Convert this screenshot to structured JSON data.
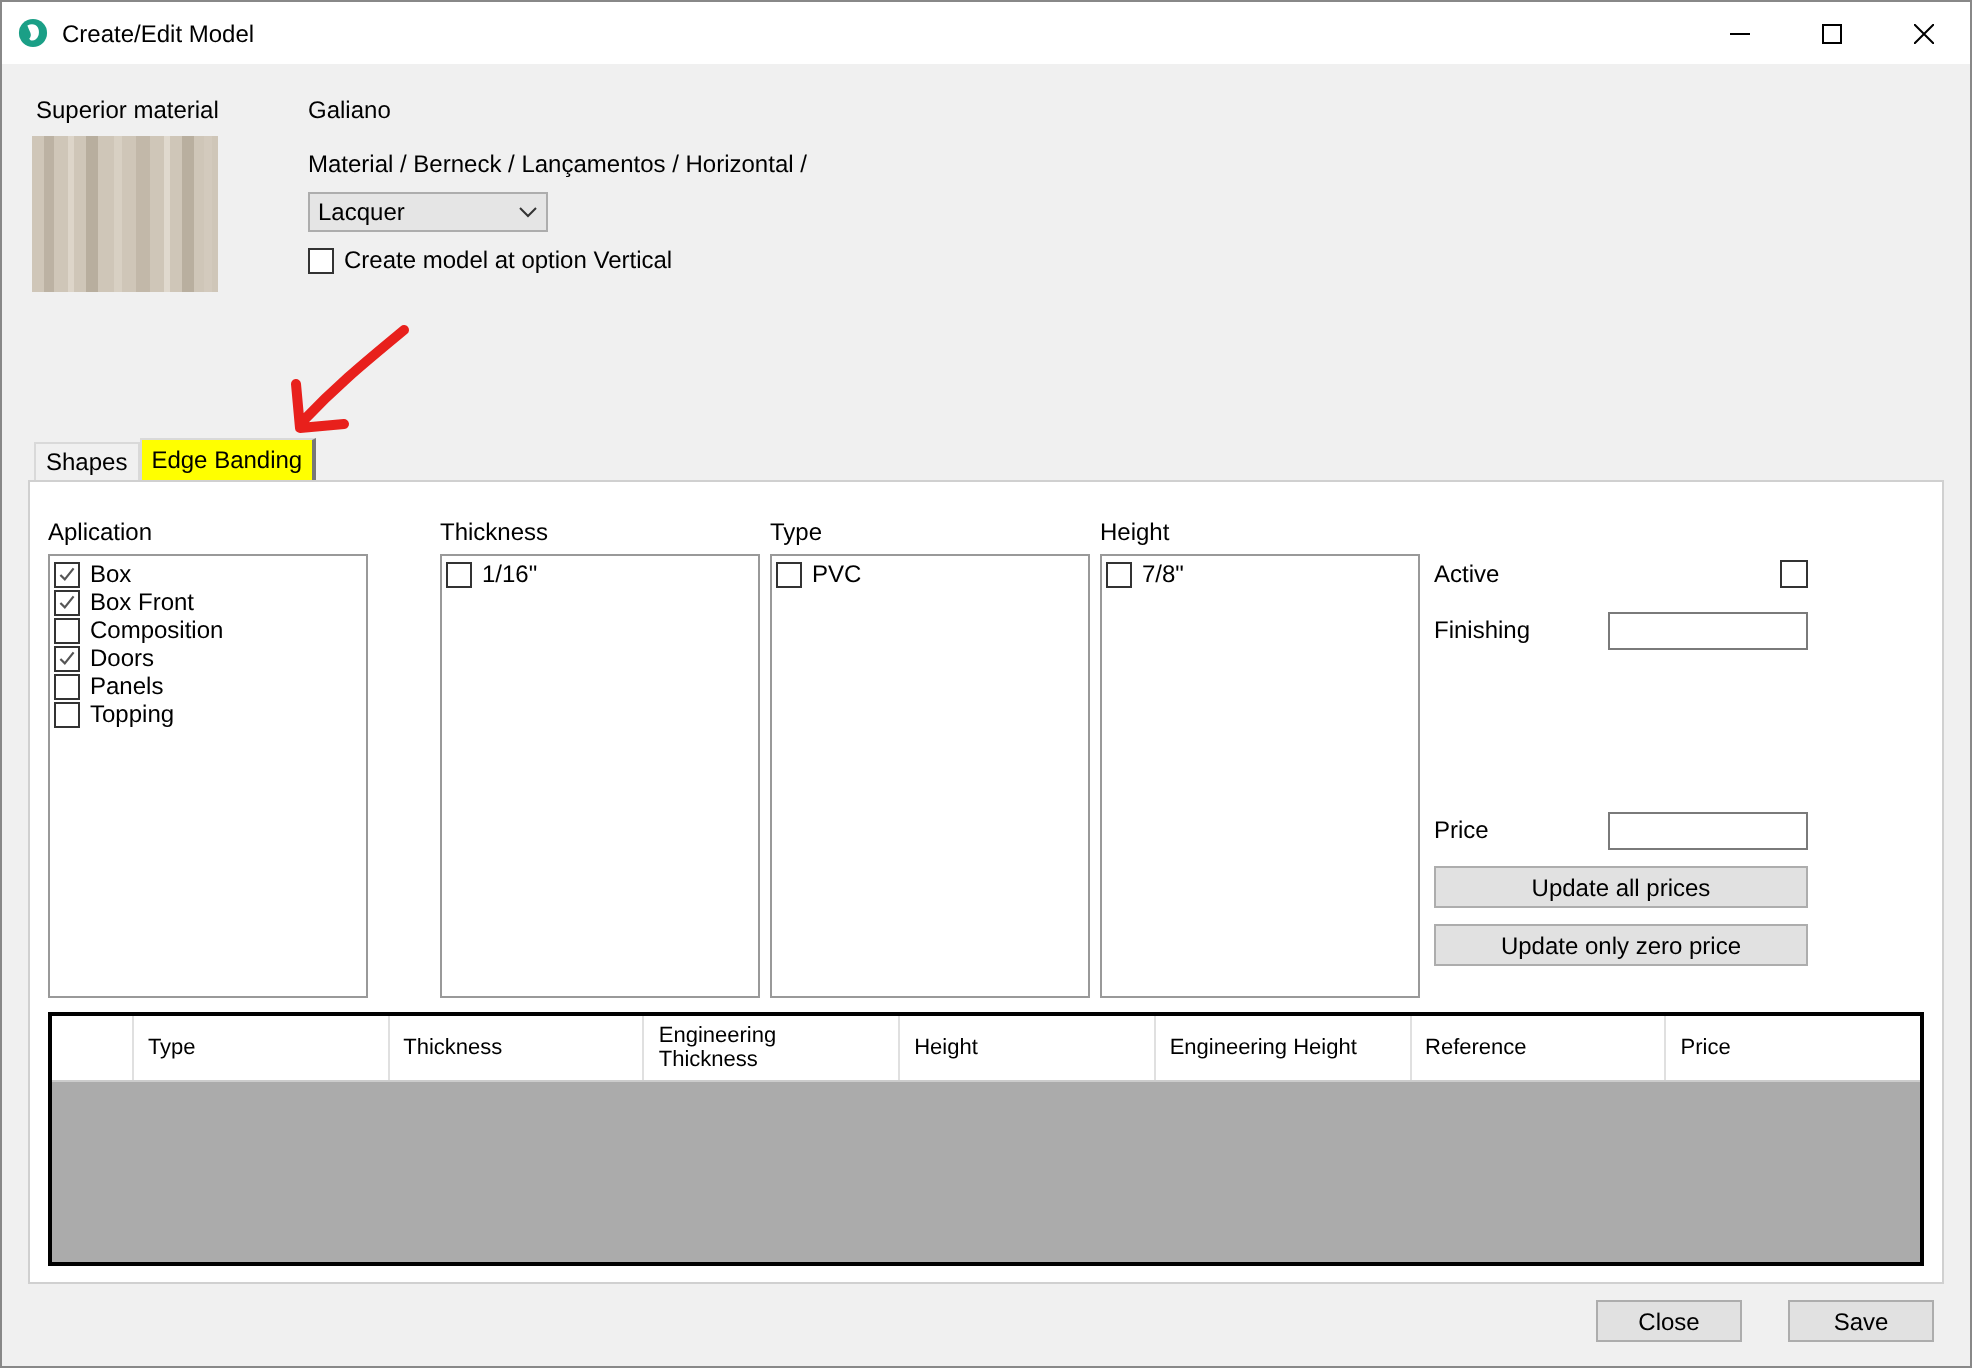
{
  "window": {
    "title": "Create/Edit Model"
  },
  "material": {
    "label": "Superior material",
    "name": "Galiano",
    "path": "Material / Berneck / Lançamentos / Horizontal /",
    "finish": "Lacquer",
    "vertical_option": {
      "label": "Create model at option Vertical",
      "checked": false
    }
  },
  "tabs": [
    {
      "label": "Shapes",
      "selected": false,
      "highlighted": false
    },
    {
      "label": "Edge Banding",
      "selected": true,
      "highlighted": true
    }
  ],
  "lists": [
    {
      "title": "Aplication",
      "items": [
        {
          "label": "Box",
          "checked": true
        },
        {
          "label": "Box Front",
          "checked": true
        },
        {
          "label": "Composition",
          "checked": false
        },
        {
          "label": "Doors",
          "checked": true
        },
        {
          "label": "Panels",
          "checked": false
        },
        {
          "label": "Topping",
          "checked": false
        }
      ]
    },
    {
      "title": "Thickness",
      "items": [
        {
          "label": "1/16\"",
          "checked": false
        }
      ]
    },
    {
      "title": "Type",
      "items": [
        {
          "label": "PVC",
          "checked": false
        }
      ]
    },
    {
      "title": "Height",
      "items": [
        {
          "label": "7/8\"",
          "checked": false
        }
      ]
    }
  ],
  "active": {
    "label": "Active",
    "checked": false
  },
  "finishing": {
    "label": "Finishing"
  },
  "price": {
    "label": "Price"
  },
  "price_buttons": [
    "Update all prices",
    "Update only zero price"
  ],
  "table": {
    "columns": [
      "Type",
      "Thickness",
      "Engineering\nThickness",
      "Height",
      "Engineering Height",
      "Reference",
      "Price"
    ]
  },
  "buttons": [
    "Close",
    "Save"
  ]
}
